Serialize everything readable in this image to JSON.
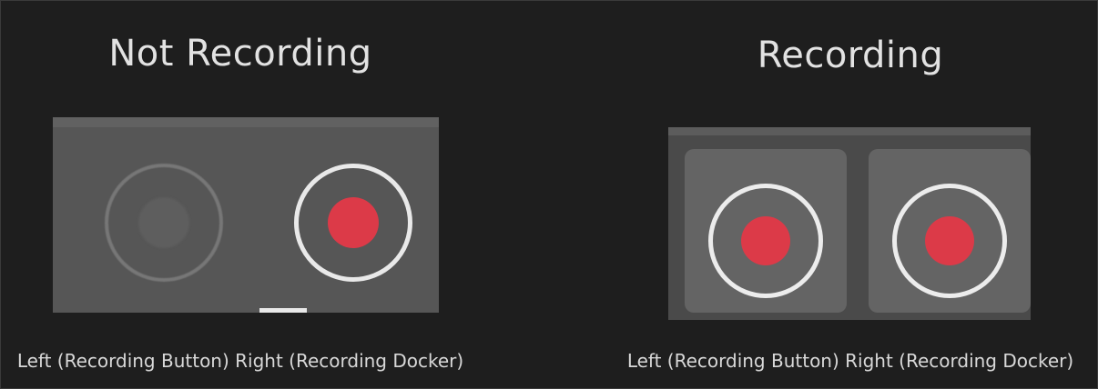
{
  "not_recording": {
    "title": "Not Recording",
    "caption": "Left (Recording Button) Right (Recording Docker)",
    "left_control": {
      "icon": "record-icon",
      "state": "disabled"
    },
    "right_control": {
      "icon": "record-icon",
      "state": "idle"
    }
  },
  "recording": {
    "title": "Recording",
    "caption": "Left (Recording Button) Right (Recording Docker)",
    "left_control": {
      "icon": "record-icon",
      "state": "active"
    },
    "right_control": {
      "icon": "record-icon",
      "state": "active"
    }
  },
  "colors": {
    "background": "#1e1e1e",
    "record_red": "#dc3a48",
    "ring_white": "#e9e9e9",
    "ring_disabled": "#777777"
  }
}
